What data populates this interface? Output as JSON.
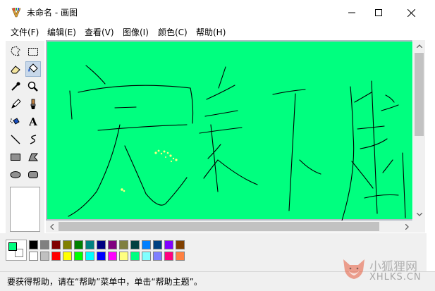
{
  "window": {
    "title": "未命名 - 画图",
    "minimize_glyph": "—",
    "maximize_glyph": "☐",
    "close_glyph": "✕"
  },
  "menu": [
    "文件(F)",
    "编辑(E)",
    "查看(V)",
    "图像(I)",
    "颜色(C)",
    "帮助(H)"
  ],
  "tools": [
    {
      "name": "free-form-select-icon"
    },
    {
      "name": "rect-select-icon"
    },
    {
      "name": "eraser-icon"
    },
    {
      "name": "fill-bucket-icon",
      "active": true
    },
    {
      "name": "color-picker-icon"
    },
    {
      "name": "magnifier-icon"
    },
    {
      "name": "pencil-icon"
    },
    {
      "name": "brush-icon"
    },
    {
      "name": "airbrush-icon"
    },
    {
      "name": "text-icon",
      "glyph": "A"
    },
    {
      "name": "line-icon"
    },
    {
      "name": "curve-icon"
    },
    {
      "name": "rectangle-icon"
    },
    {
      "name": "polygon-icon"
    },
    {
      "name": "ellipse-icon"
    },
    {
      "name": "rounded-rect-icon"
    }
  ],
  "colors": {
    "canvas": "#00ff7f",
    "foreground": "#00ff7f",
    "background": "#ffffff",
    "stroke": "#000000",
    "spray": "#ffff80"
  },
  "palette": {
    "row1": [
      "#000000",
      "#808080",
      "#800000",
      "#808000",
      "#008000",
      "#008080",
      "#000080",
      "#800080",
      "#808040",
      "#004040",
      "#0080ff",
      "#004080",
      "#8000ff",
      "#804000"
    ],
    "row2": [
      "#ffffff",
      "#c0c0c0",
      "#ff0000",
      "#ffff00",
      "#00ff00",
      "#00ffff",
      "#0000ff",
      "#ff00ff",
      "#ffff80",
      "#00ff80",
      "#80ffff",
      "#8080ff",
      "#ff0080",
      "#ff8040"
    ]
  },
  "status": {
    "text": "要获得帮助，请在“帮助”菜单中，单击“帮助主题”。"
  },
  "watermark": {
    "cn": "小狐狸网",
    "en": "XHLKS.CN"
  }
}
